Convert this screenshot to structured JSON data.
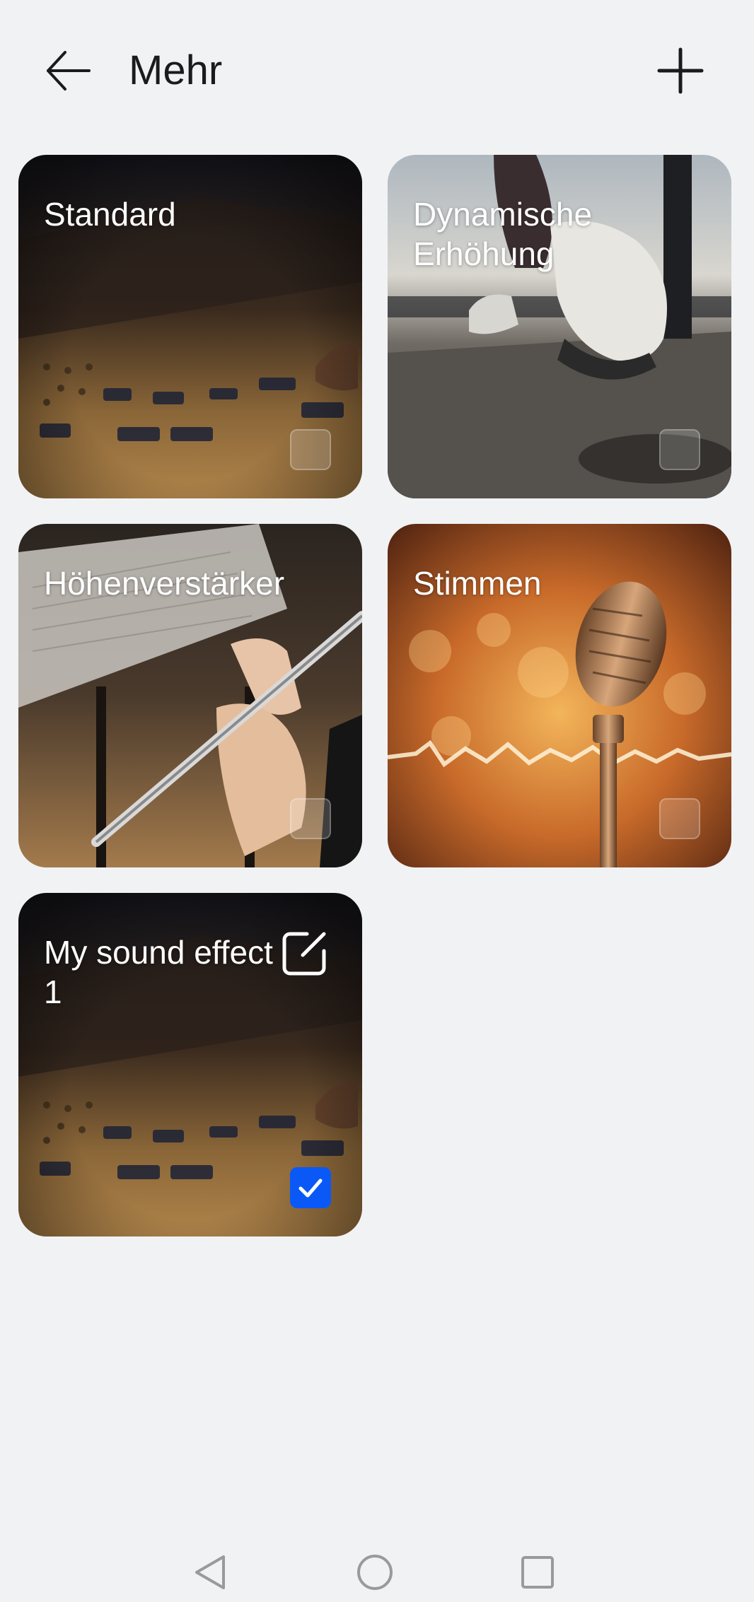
{
  "header": {
    "title": "Mehr",
    "back_icon": "arrow-left-icon",
    "add_icon": "plus-icon"
  },
  "effects": [
    {
      "label": "Standard",
      "image": "mixing-console",
      "selected": false
    },
    {
      "label": "Dynamische Erhöhung",
      "image": "running-shoe-treadmill",
      "selected": false
    },
    {
      "label": "Höhenverstärker",
      "image": "flute-player",
      "selected": false
    },
    {
      "label": "Stimmen",
      "image": "vintage-microphone",
      "selected": false
    },
    {
      "label": "My sound effect 1",
      "image": "mixing-console",
      "selected": true,
      "editable": true
    }
  ],
  "navbar": {
    "back_icon": "triangle-back-icon",
    "home_icon": "circle-home-icon",
    "recents_icon": "square-recents-icon"
  },
  "colors": {
    "background": "#f1f2f4",
    "accent": "#0a59f7",
    "title_text": "#1b1b1b"
  }
}
